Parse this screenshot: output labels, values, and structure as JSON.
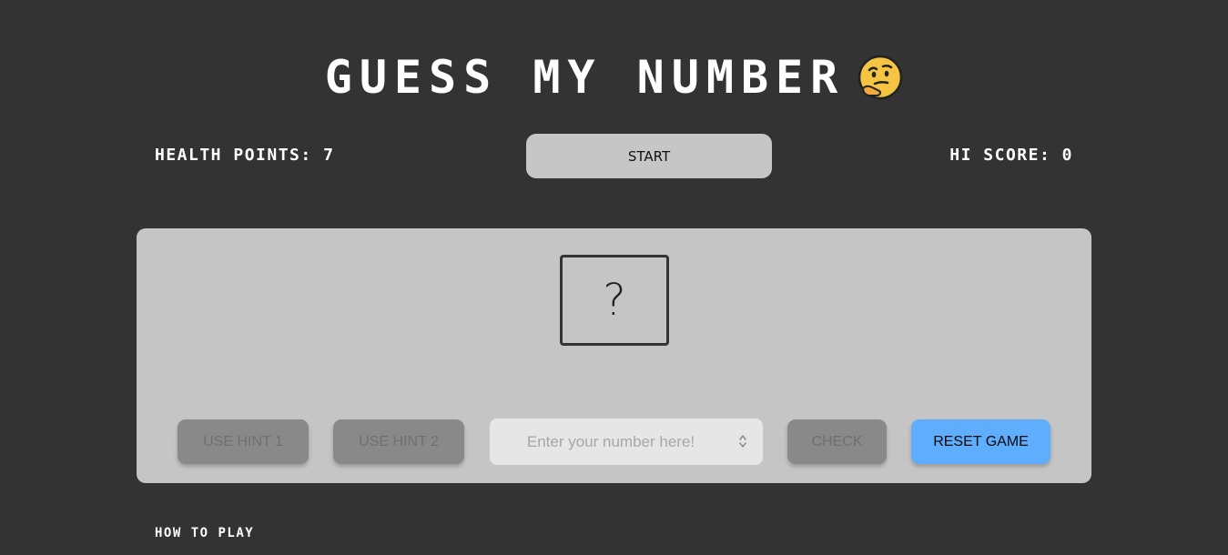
{
  "header": {
    "title": "GUESS MY NUMBER",
    "emoji_icon": "thinking-face-icon"
  },
  "stats": {
    "health_label": "HEALTH POINTS:",
    "health_value": "7",
    "hiscore_label": "HI SCORE:",
    "hiscore_value": "0"
  },
  "controls": {
    "start_label": "START",
    "secret_display": "?",
    "hint1_label": "USE HINT 1",
    "hint2_label": "USE HINT 2",
    "input_placeholder": "Enter your number here!",
    "input_value": "",
    "check_label": "CHECK",
    "reset_label": "RESET GAME"
  },
  "footer": {
    "how_to_play": "HOW TO PLAY"
  },
  "colors": {
    "background": "#333333",
    "panel": "#c5c5c5",
    "disabled_button": "#898989",
    "reset_button": "#5fadfd",
    "start_button": "#c6c6c6"
  }
}
